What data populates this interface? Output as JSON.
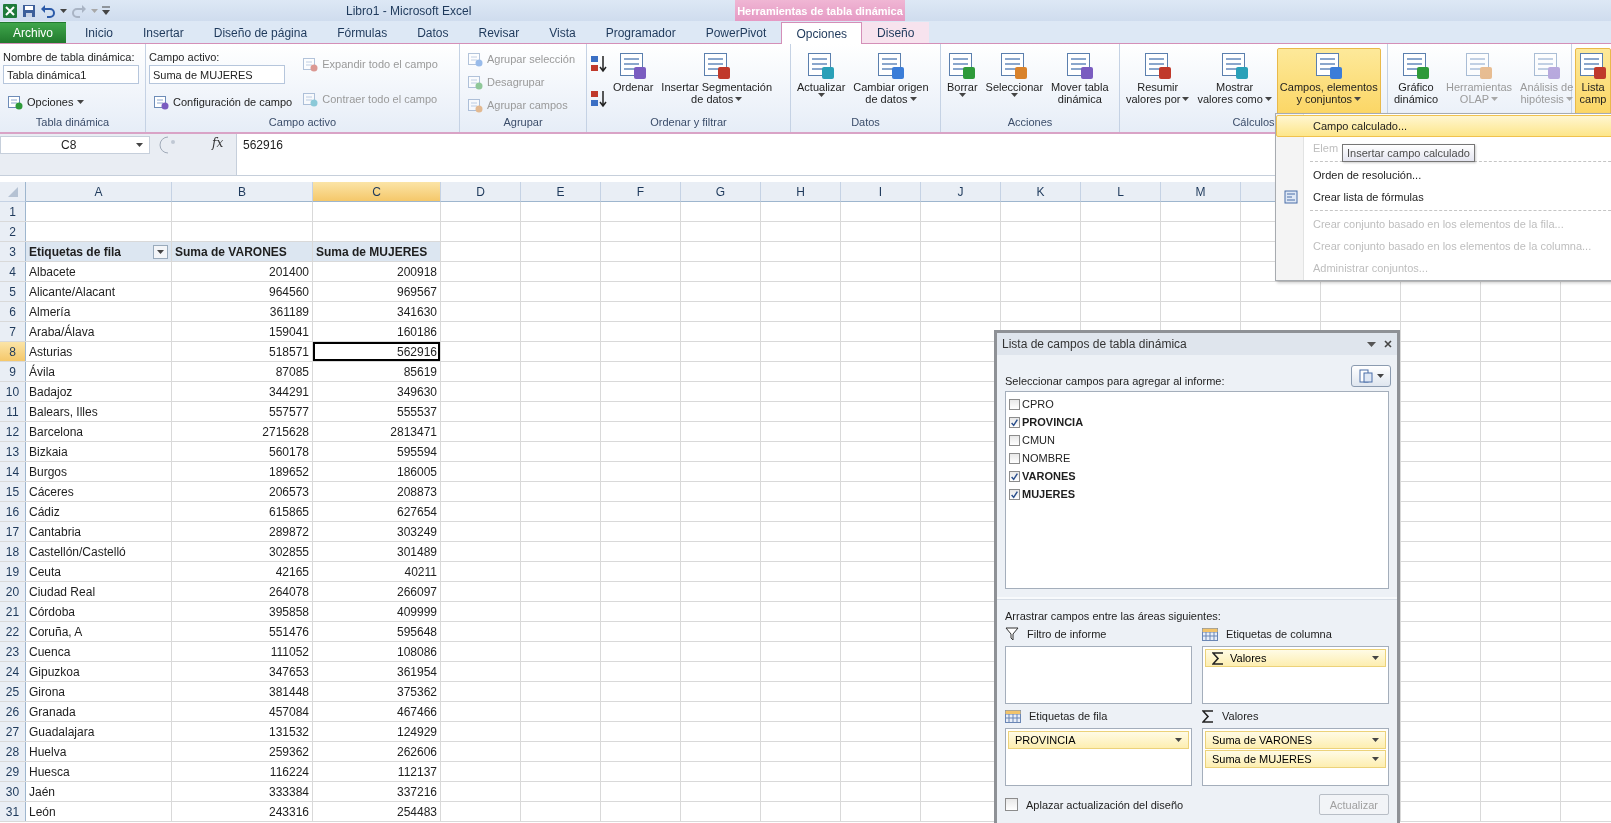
{
  "title_bar": {
    "title": "Libro1  -  Microsoft Excel",
    "context_tab": "Herramientas de tabla dinámica"
  },
  "tabs": [
    {
      "label": "Archivo",
      "kind": "file",
      "selected": false
    },
    {
      "label": "Inicio",
      "kind": "normal",
      "selected": false
    },
    {
      "label": "Insertar",
      "kind": "normal",
      "selected": false
    },
    {
      "label": "Diseño de página",
      "kind": "normal",
      "selected": false
    },
    {
      "label": "Fórmulas",
      "kind": "normal",
      "selected": false
    },
    {
      "label": "Datos",
      "kind": "normal",
      "selected": false
    },
    {
      "label": "Revisar",
      "kind": "normal",
      "selected": false
    },
    {
      "label": "Vista",
      "kind": "normal",
      "selected": false
    },
    {
      "label": "Programador",
      "kind": "normal",
      "selected": false
    },
    {
      "label": "PowerPivot",
      "kind": "normal",
      "selected": false
    },
    {
      "label": "Opciones",
      "kind": "context",
      "selected": true
    },
    {
      "label": "Diseño",
      "kind": "context",
      "selected": false
    }
  ],
  "ribbon": {
    "groups": [
      {
        "label": "Tabla dinámica",
        "columns": [
          [
            {
              "kind": "field",
              "label": "Nombre de tabla dinámica:",
              "value": "Tabla dinámica1"
            },
            {
              "kind": "small",
              "text": "Opciones",
              "dropdown": true,
              "disabled": false
            }
          ]
        ]
      },
      {
        "label": "Campo activo",
        "columns": [
          [
            {
              "kind": "field",
              "label": "Campo activo:",
              "value": "Suma de MUJERES"
            },
            {
              "kind": "small",
              "text": "Configuración de campo",
              "dropdown": false,
              "disabled": false
            }
          ],
          [
            {
              "kind": "small",
              "text": "Expandir todo el campo",
              "dropdown": false,
              "disabled": true
            },
            {
              "kind": "small",
              "text": "Contraer todo el campo",
              "dropdown": false,
              "disabled": true
            }
          ]
        ]
      },
      {
        "label": "Agrupar",
        "columns": [
          [
            {
              "kind": "small",
              "text": "Agrupar selección",
              "dropdown": false,
              "disabled": true
            },
            {
              "kind": "small",
              "text": "Desagrupar",
              "dropdown": false,
              "disabled": true
            },
            {
              "kind": "small",
              "text": "Agrupar campos",
              "dropdown": false,
              "disabled": true
            }
          ]
        ]
      },
      {
        "label": "Ordenar y filtrar",
        "columns": [
          [
            {
              "kind": "icon_button",
              "disabled": false
            },
            {
              "kind": "icon_button",
              "disabled": false
            }
          ],
          [
            {
              "kind": "large",
              "lines": [
                "Ordenar"
              ],
              "dropdown": false,
              "disabled": false,
              "selected": false
            }
          ],
          [
            {
              "kind": "large",
              "lines": [
                "Insertar Segmentación",
                "de datos"
              ],
              "dropdown": true,
              "disabled": false,
              "selected": false
            }
          ]
        ]
      },
      {
        "label": "Datos",
        "columns": [
          [
            {
              "kind": "large",
              "lines": [
                "Actualizar"
              ],
              "dropdown": true,
              "disabled": false,
              "selected": false
            }
          ],
          [
            {
              "kind": "large",
              "lines": [
                "Cambiar origen",
                "de datos"
              ],
              "dropdown": true,
              "disabled": false,
              "selected": false
            }
          ]
        ]
      },
      {
        "label": "Acciones",
        "columns": [
          [
            {
              "kind": "large",
              "lines": [
                "Borrar"
              ],
              "dropdown": true,
              "disabled": false,
              "selected": false
            }
          ],
          [
            {
              "kind": "large",
              "lines": [
                "Seleccionar"
              ],
              "dropdown": true,
              "disabled": false,
              "selected": false
            }
          ],
          [
            {
              "kind": "large",
              "lines": [
                "Mover tabla",
                "dinámica"
              ],
              "dropdown": false,
              "disabled": false,
              "selected": false
            }
          ]
        ]
      },
      {
        "label": "Cálculos",
        "columns": [
          [
            {
              "kind": "large",
              "lines": [
                "Resumir",
                "valores por"
              ],
              "dropdown": true,
              "disabled": false,
              "selected": false
            }
          ],
          [
            {
              "kind": "large",
              "lines": [
                "Mostrar",
                "valores como"
              ],
              "dropdown": true,
              "disabled": false,
              "selected": false
            }
          ],
          [
            {
              "kind": "large",
              "lines": [
                "Campos, elementos",
                "y conjuntos"
              ],
              "dropdown": true,
              "disabled": false,
              "selected": true
            }
          ]
        ]
      },
      {
        "columns": [
          [
            {
              "kind": "large",
              "lines": [
                "Gráfico",
                "dinámico"
              ],
              "dropdown": false,
              "disabled": false,
              "selected": false
            }
          ],
          [
            {
              "kind": "large",
              "lines": [
                "Herramientas",
                "OLAP"
              ],
              "dropdown": true,
              "disabled": true,
              "selected": false
            }
          ],
          [
            {
              "kind": "large",
              "lines": [
                "Análisis de",
                "hipótesis"
              ],
              "dropdown": true,
              "disabled": true,
              "selected": false
            }
          ]
        ]
      },
      {
        "columns": [
          [
            {
              "kind": "large",
              "lines": [
                "Lista",
                "camp"
              ],
              "dropdown": false,
              "disabled": false,
              "selected": true
            }
          ]
        ]
      }
    ]
  },
  "formula_bar": {
    "name_box": "C8",
    "function_button": "fx",
    "formula": "562916"
  },
  "sheet": {
    "columns": [
      {
        "label": "A",
        "selected": false
      },
      {
        "label": "B",
        "selected": false
      },
      {
        "label": "C",
        "selected": true
      },
      {
        "label": "D",
        "selected": false
      },
      {
        "label": "E",
        "selected": false
      },
      {
        "label": "F",
        "selected": false
      },
      {
        "label": "G",
        "selected": false
      },
      {
        "label": "H",
        "selected": false
      },
      {
        "label": "I",
        "selected": false
      },
      {
        "label": "J",
        "selected": false
      },
      {
        "label": "K",
        "selected": false
      },
      {
        "label": "L",
        "selected": false
      },
      {
        "label": "M",
        "selected": false
      }
    ],
    "rows": [
      {
        "number": "1",
        "kind": "blank",
        "selected": false
      },
      {
        "number": "2",
        "kind": "blank",
        "selected": false
      },
      {
        "number": "3",
        "kind": "header",
        "selected": false,
        "cells": [
          "Etiquetas de fila",
          "Suma de VARONES",
          "Suma de MUJERES"
        ]
      },
      {
        "number": "4",
        "kind": "data",
        "selected": false,
        "cells": [
          "Albacete",
          "201400",
          "200918"
        ]
      },
      {
        "number": "5",
        "kind": "data",
        "selected": false,
        "cells": [
          "Alicante/Alacant",
          "964560",
          "969567"
        ]
      },
      {
        "number": "6",
        "kind": "data",
        "selected": false,
        "cells": [
          "Almería",
          "361189",
          "341630"
        ]
      },
      {
        "number": "7",
        "kind": "data",
        "selected": false,
        "cells": [
          "Araba/Álava",
          "159041",
          "160186"
        ]
      },
      {
        "number": "8",
        "kind": "data",
        "selected": true,
        "cells": [
          "Asturias",
          "518571",
          "562916"
        ]
      },
      {
        "number": "9",
        "kind": "data",
        "selected": false,
        "cells": [
          "Ávila",
          "87085",
          "85619"
        ]
      },
      {
        "number": "10",
        "kind": "data",
        "selected": false,
        "cells": [
          "Badajoz",
          "344291",
          "349630"
        ]
      },
      {
        "number": "11",
        "kind": "data",
        "selected": false,
        "cells": [
          "Balears, Illes",
          "557577",
          "555537"
        ]
      },
      {
        "number": "12",
        "kind": "data",
        "selected": false,
        "cells": [
          "Barcelona",
          "2715628",
          "2813471"
        ]
      },
      {
        "number": "13",
        "kind": "data",
        "selected": false,
        "cells": [
          "Bizkaia",
          "560178",
          "595594"
        ]
      },
      {
        "number": "14",
        "kind": "data",
        "selected": false,
        "cells": [
          "Burgos",
          "189652",
          "186005"
        ]
      },
      {
        "number": "15",
        "kind": "data",
        "selected": false,
        "cells": [
          "Cáceres",
          "206573",
          "208873"
        ]
      },
      {
        "number": "16",
        "kind": "data",
        "selected": false,
        "cells": [
          "Cádiz",
          "615865",
          "627654"
        ]
      },
      {
        "number": "17",
        "kind": "data",
        "selected": false,
        "cells": [
          "Cantabria",
          "289872",
          "303249"
        ]
      },
      {
        "number": "18",
        "kind": "data",
        "selected": false,
        "cells": [
          "Castellón/Castelló",
          "302855",
          "301489"
        ]
      },
      {
        "number": "19",
        "kind": "data",
        "selected": false,
        "cells": [
          "Ceuta",
          "42165",
          "40211"
        ]
      },
      {
        "number": "20",
        "kind": "data",
        "selected": false,
        "cells": [
          "Ciudad Real",
          "264078",
          "266097"
        ]
      },
      {
        "number": "21",
        "kind": "data",
        "selected": false,
        "cells": [
          "Córdoba",
          "395858",
          "409999"
        ]
      },
      {
        "number": "22",
        "kind": "data",
        "selected": false,
        "cells": [
          "Coruña, A",
          "551476",
          "595648"
        ]
      },
      {
        "number": "23",
        "kind": "data",
        "selected": false,
        "cells": [
          "Cuenca",
          "111052",
          "108086"
        ]
      },
      {
        "number": "24",
        "kind": "data",
        "selected": false,
        "cells": [
          "Gipuzkoa",
          "347653",
          "361954"
        ]
      },
      {
        "number": "25",
        "kind": "data",
        "selected": false,
        "cells": [
          "Girona",
          "381448",
          "375362"
        ]
      },
      {
        "number": "26",
        "kind": "data",
        "selected": false,
        "cells": [
          "Granada",
          "457084",
          "467466"
        ]
      },
      {
        "number": "27",
        "kind": "data",
        "selected": false,
        "cells": [
          "Guadalajara",
          "131532",
          "124929"
        ]
      },
      {
        "number": "28",
        "kind": "data",
        "selected": false,
        "cells": [
          "Huelva",
          "259362",
          "262606"
        ]
      },
      {
        "number": "29",
        "kind": "data",
        "selected": false,
        "cells": [
          "Huesca",
          "116224",
          "112137"
        ]
      },
      {
        "number": "30",
        "kind": "data",
        "selected": false,
        "cells": [
          "Jaén",
          "333384",
          "337216"
        ]
      },
      {
        "number": "31",
        "kind": "data",
        "selected": false,
        "cells": [
          "León",
          "243316",
          "254483"
        ]
      }
    ]
  },
  "menu": {
    "sections": [
      {
        "items": [
          {
            "label": "Campo calculado...",
            "selected": true,
            "disabled": false,
            "icon": false
          },
          {
            "label": "Elem",
            "selected": false,
            "disabled": true,
            "icon": false
          }
        ]
      },
      {
        "items": [
          {
            "label": "Orden de resolución...",
            "selected": false,
            "disabled": false,
            "icon": false
          },
          {
            "label": "Crear lista de fórmulas",
            "selected": false,
            "disabled": false,
            "icon": true
          }
        ]
      },
      {
        "items": [
          {
            "label": "Crear conjunto basado en los elementos de la fila...",
            "selected": false,
            "disabled": true,
            "icon": false
          },
          {
            "label": "Crear conjunto basado en los elementos de la columna...",
            "selected": false,
            "disabled": true,
            "icon": false
          },
          {
            "label": "Administrar conjuntos...",
            "selected": false,
            "disabled": true,
            "icon": false
          }
        ]
      }
    ]
  },
  "tooltip": "Insertar campo calculado",
  "pane": {
    "title": "Lista de campos de tabla dinámica",
    "choose_label": "Seleccionar campos para agregar al informe:",
    "fields": [
      {
        "name": "CPRO",
        "checked": false
      },
      {
        "name": "PROVINCIA",
        "checked": true
      },
      {
        "name": "CMUN",
        "checked": false
      },
      {
        "name": "NOMBRE",
        "checked": false
      },
      {
        "name": "VARONES",
        "checked": true
      },
      {
        "name": "MUJERES",
        "checked": true
      }
    ],
    "drag_label": "Arrastrar campos entre las áreas siguientes:",
    "areas": [
      {
        "label": "Filtro de informe"
      },
      {
        "label": "Etiquetas de columna",
        "items": [
          {
            "text": "Valores",
            "kind": "values"
          }
        ]
      },
      {
        "label": "Etiquetas de fila",
        "items": [
          {
            "text": "PROVINCIA",
            "kind": "field"
          }
        ]
      },
      {
        "label": "Valores",
        "items": [
          {
            "text": "Suma de VARONES",
            "kind": "field"
          },
          {
            "text": "Suma de MUJERES",
            "kind": "field"
          }
        ]
      }
    ],
    "defer": {
      "label": "Aplazar actualización del diseño",
      "checked": false
    },
    "update_button": {
      "label": "Actualizar",
      "disabled": true
    }
  }
}
